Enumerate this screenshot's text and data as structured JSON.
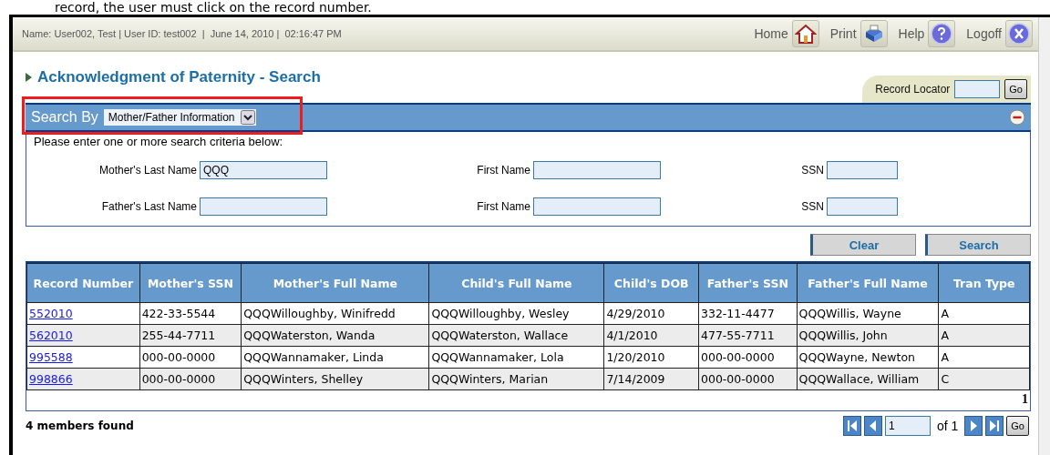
{
  "caption": "record, the user must click on the record number.",
  "header": {
    "user_info": "Name: User002, Test | User ID: test002  |  June 14, 2010 |  02:16:47 PM",
    "nav": [
      {
        "label": "Home",
        "kind": "home"
      },
      {
        "label": "Print",
        "kind": "print"
      },
      {
        "label": "Help",
        "kind": "help"
      },
      {
        "label": "Logoff",
        "kind": "logoff"
      }
    ]
  },
  "page_title": "Acknowledgment of Paternity - Search",
  "record_locator": {
    "label": "Record Locator",
    "button": "Go"
  },
  "search_by": {
    "label": "Search By",
    "value": "Mother/Father Information",
    "expanded": true
  },
  "criteria": {
    "instruction": "Please enter one or more search criteria below:",
    "rows": [
      [
        {
          "label": "Mother's Last Name",
          "value": "QQQ"
        },
        {
          "label": "First Name"
        },
        {
          "label": "SSN"
        }
      ],
      [
        {
          "label": "Father's Last Name"
        },
        {
          "label": "First Name"
        },
        {
          "label": "SSN"
        }
      ]
    ]
  },
  "buttons": [
    "Clear",
    "Search"
  ],
  "table": {
    "columns": [
      "Record Number",
      "Mother's SSN",
      "Mother's Full Name",
      "Child's Full Name",
      "Child's DOB",
      "Father's SSN",
      "Father's Full Name",
      "Tran Type"
    ],
    "rows": [
      [
        "552010",
        "422-33-5544",
        "QQQWilloughby, Winifredd",
        "QQQWilloughby, Wesley",
        "4/29/2010",
        "332-11-4477",
        "QQQWillis, Wayne",
        "A"
      ],
      [
        "562010",
        "255-44-7711",
        "QQQWaterston, Wanda",
        "QQQWaterston, Wallace",
        "4/1/2010",
        "477-55-7711",
        "QQQWillis, John",
        "A"
      ],
      [
        "995588",
        "000-00-0000",
        "QQQWannamaker, Linda",
        "QQQWannamaker, Lola",
        "1/20/2010",
        "000-00-0000",
        "QQQWayne, Newton",
        "A"
      ],
      [
        "998866",
        "000-00-0000",
        "QQQWinters, Shelley",
        "QQQWinters, Marian",
        "7/14/2009",
        "000-00-0000",
        "QQQWallace, William",
        "C"
      ]
    ],
    "page_number": "1"
  },
  "footer": {
    "result_count": "4 members found",
    "pager": {
      "page": "1",
      "of": "of 1",
      "go": "Go"
    }
  }
}
